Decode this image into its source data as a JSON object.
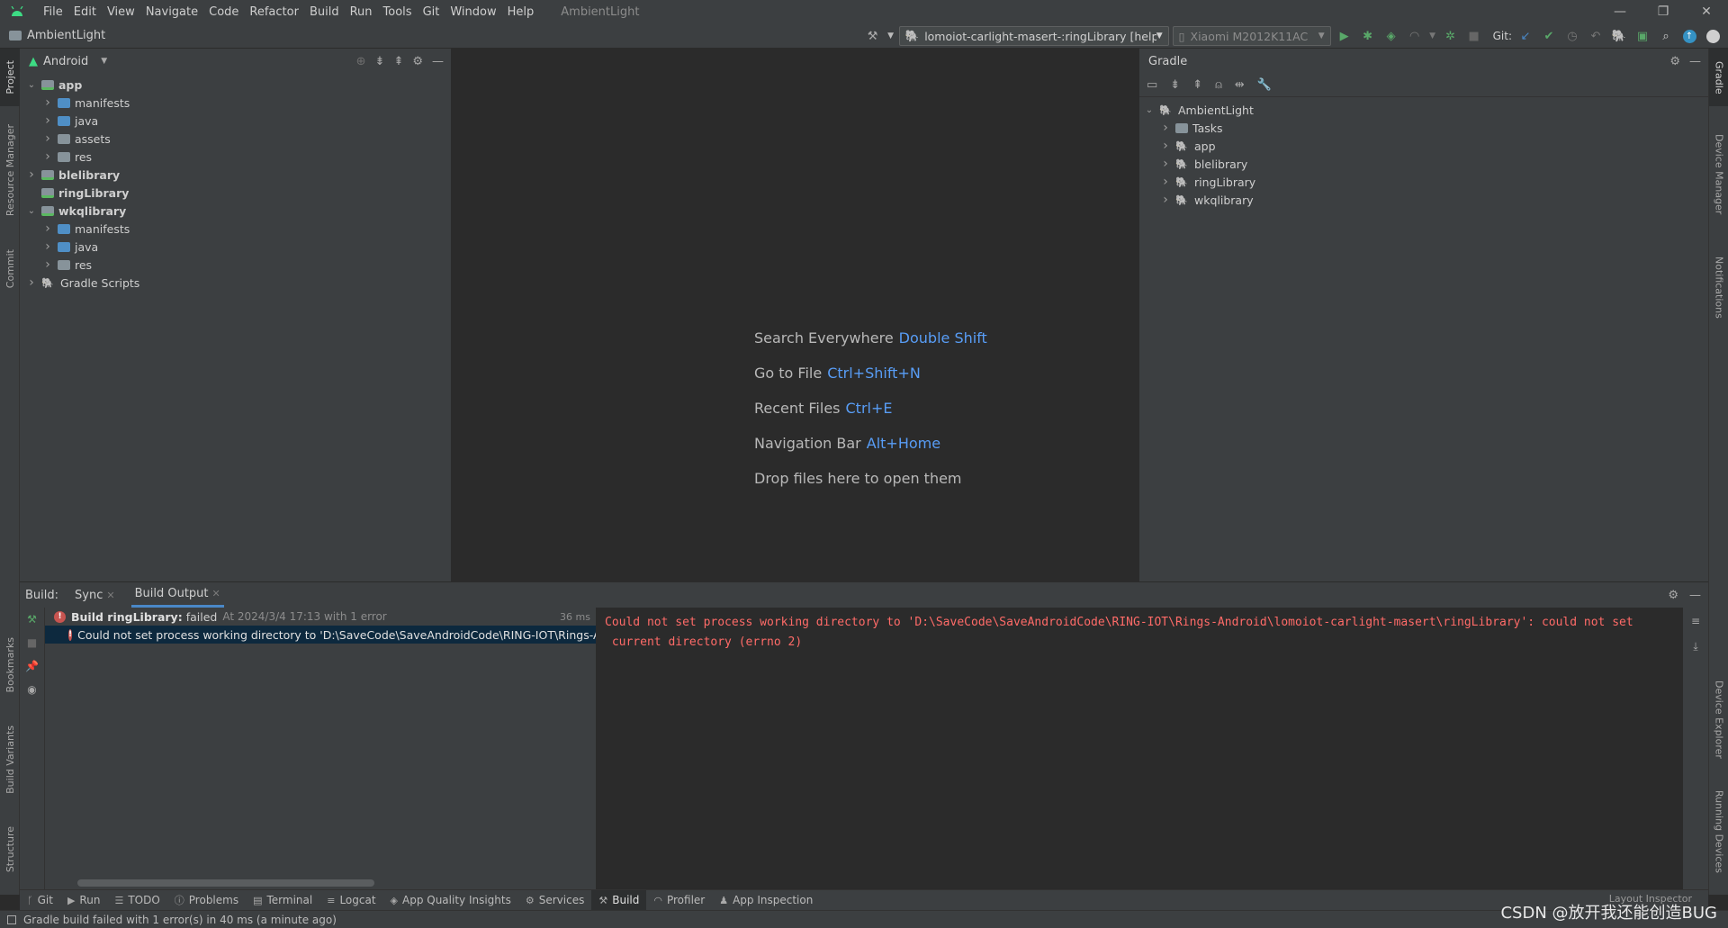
{
  "menubar": {
    "items": [
      {
        "label": "File"
      },
      {
        "label": "Edit"
      },
      {
        "label": "View"
      },
      {
        "label": "Navigate"
      },
      {
        "label": "Code"
      },
      {
        "label": "Refactor"
      },
      {
        "label": "Build"
      },
      {
        "label": "Run"
      },
      {
        "label": "Tools"
      },
      {
        "label": "Git"
      },
      {
        "label": "Window"
      },
      {
        "label": "Help"
      }
    ],
    "app_title": "AmbientLight"
  },
  "toolbar": {
    "project_name": "AmbientLight",
    "run_config": "lomoiot-carlight-masert-:ringLibrary [help]",
    "device": "Xiaomi M2012K11AC",
    "git_label": "Git:"
  },
  "left_stripe": {
    "tabs": [
      "Project",
      "Resource Manager",
      "Commit",
      "Bookmarks",
      "Build Variants",
      "Structure"
    ]
  },
  "right_stripe": {
    "tabs": [
      "Gradle",
      "Device Manager",
      "Notifications",
      "Device Explorer",
      "Running Devices"
    ]
  },
  "project_panel": {
    "view_mode": "Android",
    "tree": [
      {
        "label": "app",
        "bold": true,
        "depth": 0,
        "expanded": true,
        "icon": "module"
      },
      {
        "label": "manifests",
        "depth": 1,
        "icon": "folder-blue"
      },
      {
        "label": "java",
        "depth": 1,
        "icon": "folder-blue"
      },
      {
        "label": "assets",
        "depth": 1,
        "icon": "folder"
      },
      {
        "label": "res",
        "depth": 1,
        "icon": "folder"
      },
      {
        "label": "blelibrary",
        "bold": true,
        "depth": 0,
        "expanded": false,
        "icon": "module"
      },
      {
        "label": "ringLibrary",
        "bold": true,
        "depth": 0,
        "leaf": true,
        "icon": "module"
      },
      {
        "label": "wkqlibrary",
        "bold": true,
        "depth": 0,
        "expanded": true,
        "icon": "module"
      },
      {
        "label": "manifests",
        "depth": 1,
        "icon": "folder-blue"
      },
      {
        "label": "java",
        "depth": 1,
        "icon": "folder-blue"
      },
      {
        "label": "res",
        "depth": 1,
        "icon": "folder"
      },
      {
        "label": "Gradle Scripts",
        "depth": 0,
        "expanded": false,
        "icon": "gradle"
      }
    ]
  },
  "editor": {
    "hints": [
      {
        "text": "Search Everywhere",
        "key": "Double Shift"
      },
      {
        "text": "Go to File",
        "key": "Ctrl+Shift+N"
      },
      {
        "text": "Recent Files",
        "key": "Ctrl+E"
      },
      {
        "text": "Navigation Bar",
        "key": "Alt+Home"
      },
      {
        "text": "Drop files here to open them",
        "key": ""
      }
    ]
  },
  "gradle_panel": {
    "title": "Gradle",
    "tree": [
      {
        "label": "AmbientLight",
        "depth": 0,
        "expanded": true,
        "icon": "gradle"
      },
      {
        "label": "Tasks",
        "depth": 1,
        "icon": "tasks"
      },
      {
        "label": "app",
        "depth": 1,
        "icon": "gradle"
      },
      {
        "label": "blelibrary",
        "depth": 1,
        "icon": "gradle"
      },
      {
        "label": "ringLibrary",
        "depth": 1,
        "icon": "gradle"
      },
      {
        "label": "wkqlibrary",
        "depth": 1,
        "icon": "gradle"
      }
    ]
  },
  "build_panel": {
    "label": "Build:",
    "tabs": [
      {
        "label": "Sync",
        "active": false
      },
      {
        "label": "Build Output",
        "active": true
      }
    ],
    "tree": {
      "root_title": "Build ringLibrary:",
      "root_status": "failed",
      "root_detail": "At 2024/3/4 17:13 with 1 error",
      "root_time": "36 ms",
      "error_row": "Could not set process working directory to 'D:\\SaveCode\\SaveAndroidCode\\RING-IOT\\Rings-Android\\lomoiot-carlight-masert\\ringLibrary': could not set current directory (errno 2)"
    },
    "output": "Could not set process working directory to 'D:\\SaveCode\\SaveAndroidCode\\RING-IOT\\Rings-Android\\lomoiot-carlight-masert\\ringLibrary': could not set\n current directory (errno 2)"
  },
  "bottom_tools": [
    {
      "label": "Git",
      "icon": "git-icon"
    },
    {
      "label": "Run",
      "icon": "run-icon"
    },
    {
      "label": "TODO",
      "icon": "todo-icon"
    },
    {
      "label": "Problems",
      "icon": "problems-icon"
    },
    {
      "label": "Terminal",
      "icon": "terminal-icon"
    },
    {
      "label": "Logcat",
      "icon": "logcat-icon"
    },
    {
      "label": "App Quality Insights",
      "icon": "app-quality-icon"
    },
    {
      "label": "Services",
      "icon": "services-icon"
    },
    {
      "label": "Build",
      "icon": "build-icon",
      "active": true
    },
    {
      "label": "Profiler",
      "icon": "profiler-icon"
    },
    {
      "label": "App Inspection",
      "icon": "app-inspection-icon"
    }
  ],
  "layout_inspector": "Layout Inspector",
  "status_bar": {
    "message": "Gradle build failed with 1 error(s) in 40 ms (a minute ago)"
  },
  "watermark": "CSDN @放开我还能创造BUG",
  "colors": {
    "accent": "#4a88c7",
    "error": "#ff6b68",
    "hint_key": "#589df6",
    "android_green": "#3ddc84"
  }
}
